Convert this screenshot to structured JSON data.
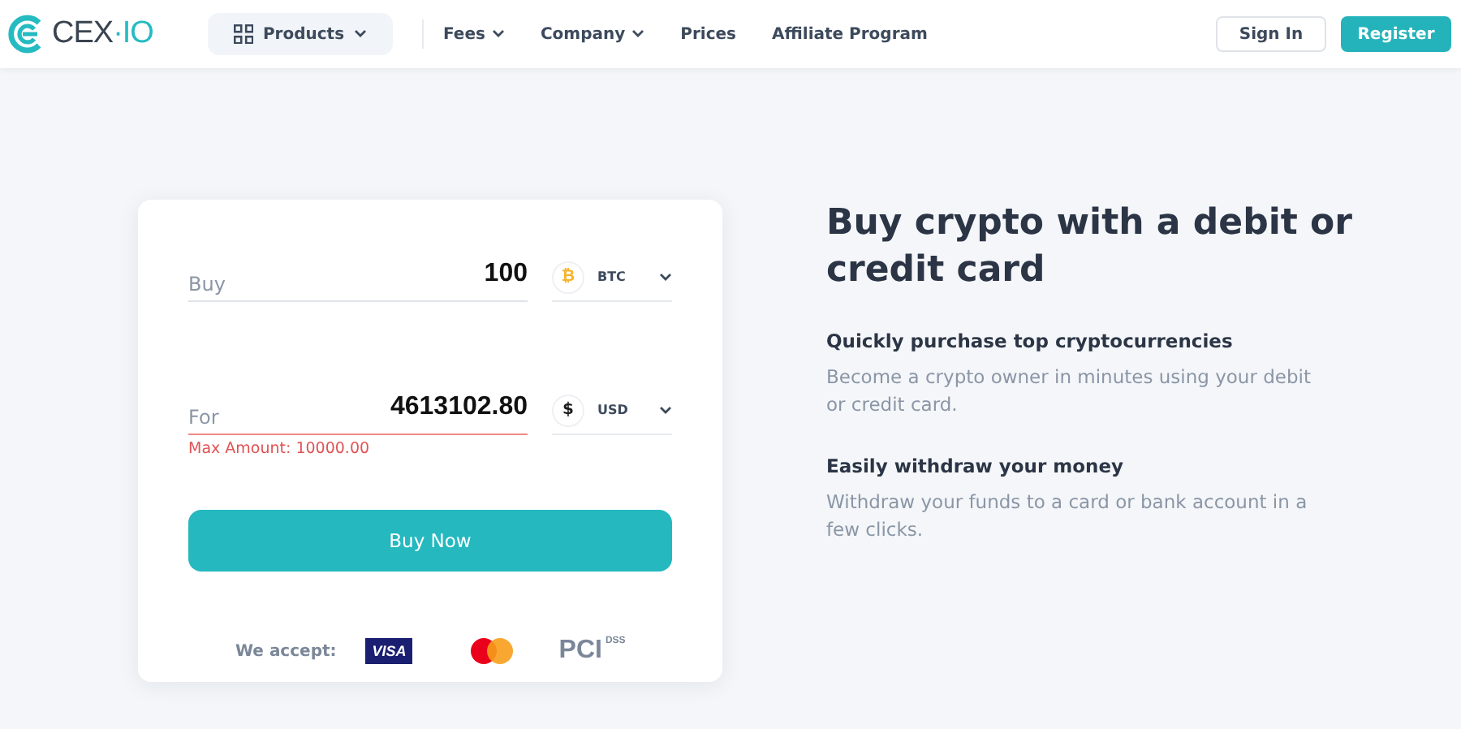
{
  "header": {
    "logo": {
      "left": "CEX",
      "dot": "·",
      "right": "IO"
    },
    "nav": [
      {
        "label": "Products",
        "kind": "products"
      },
      {
        "label": "Fees",
        "kind": "dropdown"
      },
      {
        "label": "Company",
        "kind": "dropdown"
      },
      {
        "label": "Prices",
        "kind": "link"
      },
      {
        "label": "Affiliate Program",
        "kind": "link"
      }
    ],
    "sign_in": "Sign In",
    "register": "Register"
  },
  "form": {
    "fields": [
      {
        "label": "Buy",
        "value": "100",
        "currency": "BTC",
        "currency_symbol": "₿",
        "color": "#f7b32b",
        "invalid": false
      },
      {
        "label": "For",
        "value": "4613102.80",
        "currency": "USD",
        "currency_symbol": "$",
        "color": "#1b1b1b",
        "invalid": true,
        "error": "Max Amount: 10000.00"
      }
    ],
    "button": "Buy Now",
    "accept_label": "We accept:",
    "visa": "VISA",
    "pci": "PCI",
    "pci_sup": "DSS"
  },
  "info": {
    "title": "Buy crypto with a debit or credit card",
    "features": [
      {
        "heading": "Quickly purchase top cryptocurrencies",
        "text": "Become a crypto owner in minutes using your debit or credit card."
      },
      {
        "heading": "Easily withdraw your money",
        "text": "Withdraw your funds to a card or bank account in a few clicks."
      }
    ]
  }
}
